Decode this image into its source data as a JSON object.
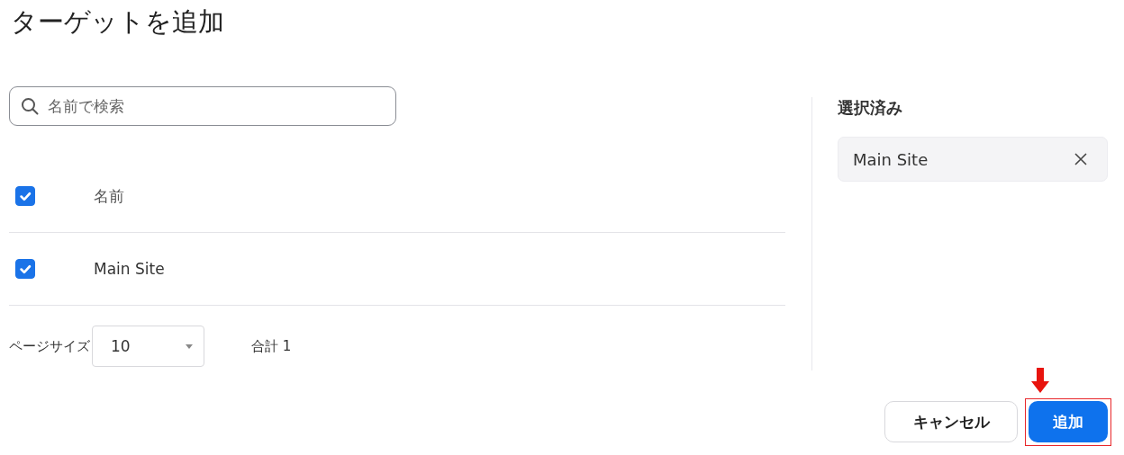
{
  "title": "ターゲットを追加",
  "search": {
    "placeholder": "名前で検索"
  },
  "table": {
    "header": {
      "label": "名前",
      "checked": true
    },
    "rows": [
      {
        "name": "Main Site",
        "checked": true
      }
    ]
  },
  "pagination": {
    "label": "ページサイズ",
    "page_size": "10",
    "total": "合計 1"
  },
  "selected_panel": {
    "title": "選択済み",
    "items": [
      {
        "name": "Main Site"
      }
    ]
  },
  "buttons": [
    {
      "label": "キャンセル",
      "kind": "secondary",
      "highlighted": false
    },
    {
      "label": "追加",
      "kind": "primary",
      "highlighted": true
    }
  ]
}
